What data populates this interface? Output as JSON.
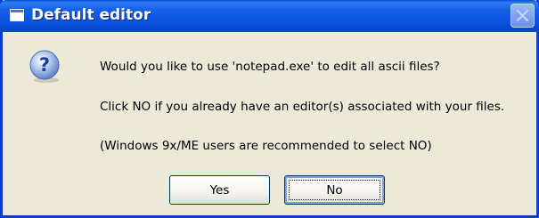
{
  "window": {
    "title": "Default editor",
    "icons": {
      "app": "window-icon",
      "close": "close-icon",
      "message": "question-icon"
    }
  },
  "message": {
    "line1": "Would you like to use 'notepad.exe' to edit all ascii files?",
    "line2": "Click NO if you already have an editor(s) associated with your files.",
    "line3": "(Windows 9x/ME users are recommended to select NO)"
  },
  "buttons": {
    "yes": "Yes",
    "no": "No"
  },
  "colors": {
    "titlebar": "#0a52df",
    "window_bg": "#ece9d8",
    "border": "#0a3fc8"
  }
}
